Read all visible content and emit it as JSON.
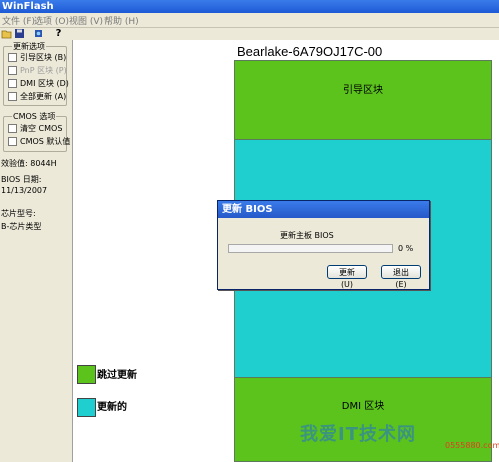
{
  "window": {
    "title": "WinFlash"
  },
  "menu": [
    "文件 (F)",
    "选项 (O)",
    "视图 (V)",
    "帮助 (H)"
  ],
  "toolbar": {
    "icons": [
      "open-folder-icon",
      "save-disk-icon",
      "flash-chip-icon",
      "help-icon"
    ]
  },
  "sidebar": {
    "update_group": {
      "legend": "更新选项",
      "items": [
        {
          "label": "引导区块 (B)",
          "enabled": true
        },
        {
          "label": "PnP 区块 (P)",
          "enabled": false
        },
        {
          "label": "DMI 区块 (D)",
          "enabled": true
        },
        {
          "label": "全部更新 (A)",
          "enabled": true
        }
      ]
    },
    "cmos_group": {
      "legend": "CMOS 选项",
      "items": [
        {
          "label": "清空 CMOS",
          "enabled": true
        },
        {
          "label": "CMOS 默认值",
          "enabled": true
        }
      ]
    },
    "checksum": "效验值:  8044H",
    "bios_date_label": "BIOS 日期:",
    "bios_date": "11/13/2007",
    "chip_model": "芯片型号:",
    "chip_type": "B-芯片类型"
  },
  "main": {
    "chip_title": "Bearlake-6A79OJ17C-00",
    "regions": [
      {
        "label": "引导区块",
        "color": "#5cc31c"
      },
      {
        "label": "",
        "color": "#1fcfd0"
      },
      {
        "label": "DMI 区块",
        "color": "#5cc31c"
      }
    ],
    "legend": [
      {
        "label": "跳过更新",
        "color": "#5cc31c"
      },
      {
        "label": "更新的",
        "color": "#1fcfd0"
      }
    ]
  },
  "dialog": {
    "title": "更新 BIOS",
    "message": "更新主板 BIOS",
    "progress": 0,
    "percent_text": "0 %",
    "update_button": "更新(U)",
    "exit_button": "退出(E)"
  },
  "watermark": {
    "text": "我爱IT技术网",
    "url": "0555880.com"
  }
}
